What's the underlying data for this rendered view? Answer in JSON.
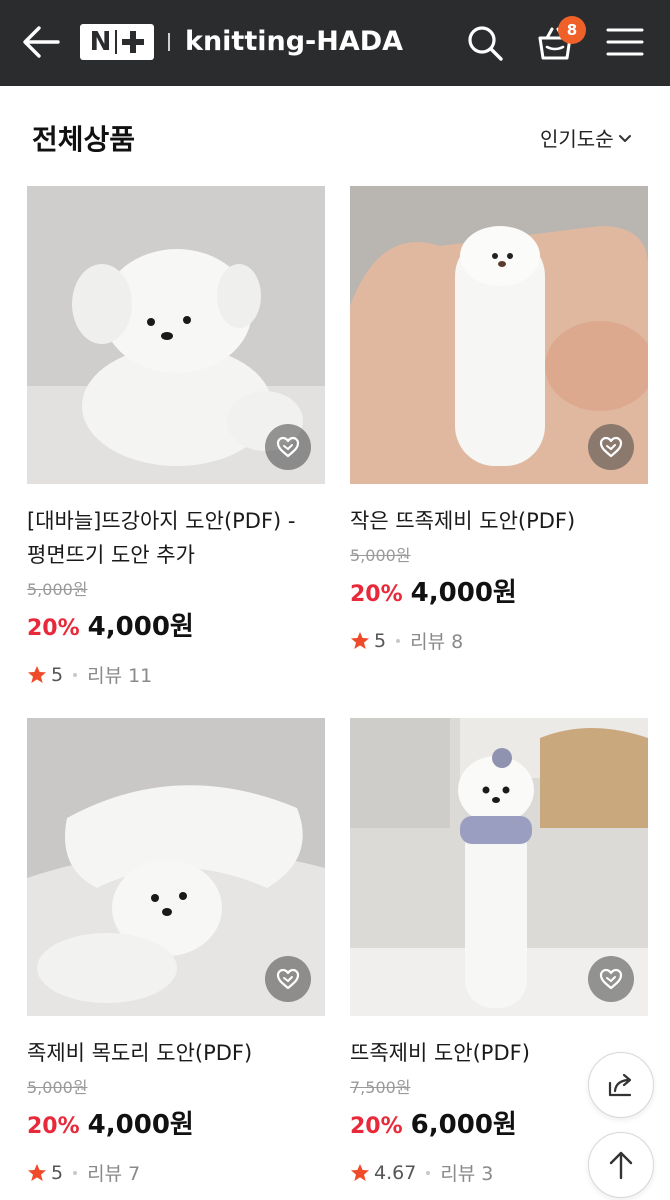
{
  "header": {
    "logo_text": "N",
    "store_name": "knitting-HADA",
    "cart_count": "8",
    "bg_color": "#2b2c2e",
    "badge_color": "#f0612a"
  },
  "section": {
    "title": "전체상품",
    "sort_label": "인기도순"
  },
  "products": [
    {
      "name": "[대바늘]뜨강아지 도안(PDF) - 평면뜨기 도안 추가",
      "original_price": "5,000원",
      "discount": "20%",
      "price": "4,000원",
      "rating": "5",
      "reviews": "리뷰 11"
    },
    {
      "name": "작은 뜨족제비 도안(PDF)",
      "original_price": "5,000원",
      "discount": "20%",
      "price": "4,000원",
      "rating": "5",
      "reviews": "리뷰 8"
    },
    {
      "name": "족제비 목도리 도안(PDF)",
      "original_price": "5,000원",
      "discount": "20%",
      "price": "4,000원",
      "rating": "5",
      "reviews": "리뷰 7"
    },
    {
      "name": "뜨족제비 도안(PDF)",
      "original_price": "7,500원",
      "discount": "20%",
      "price": "6,000원",
      "rating": "4.67",
      "reviews": "리뷰 3"
    }
  ],
  "icons": {
    "back": "arrow-left-icon",
    "search": "search-icon",
    "cart": "basket-icon",
    "menu": "hamburger-icon",
    "like": "heart-icon",
    "share": "share-icon",
    "top": "arrow-up-icon"
  },
  "colors": {
    "discount": "#e8293a",
    "star": "#ef4a2a"
  }
}
